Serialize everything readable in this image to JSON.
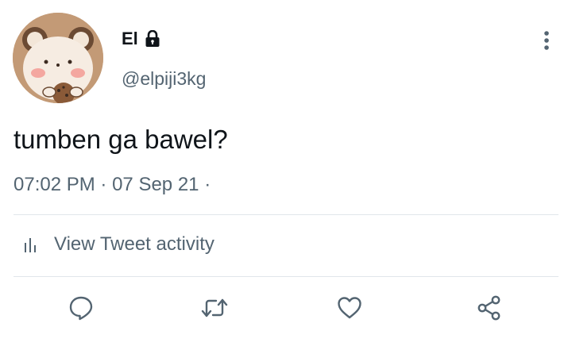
{
  "tweet": {
    "display_name": "El",
    "handle": "@elpiji3kg",
    "protected": true,
    "text": "tumben ga bawel?",
    "time": "07:02 PM",
    "date": "07 Sep 21",
    "meta_sep": "·",
    "meta_trailing": "·"
  },
  "activity": {
    "label": "View Tweet activity",
    "icon": "analytics-icon"
  },
  "actions": [
    {
      "name": "reply",
      "icon": "reply-icon"
    },
    {
      "name": "retweet",
      "icon": "retweet-icon"
    },
    {
      "name": "like",
      "icon": "heart-icon"
    },
    {
      "name": "share",
      "icon": "share-icon"
    }
  ],
  "colors": {
    "text_primary": "#0f1419",
    "text_secondary": "#536471",
    "divider": "#e1e6ea",
    "icon": "#536471"
  }
}
